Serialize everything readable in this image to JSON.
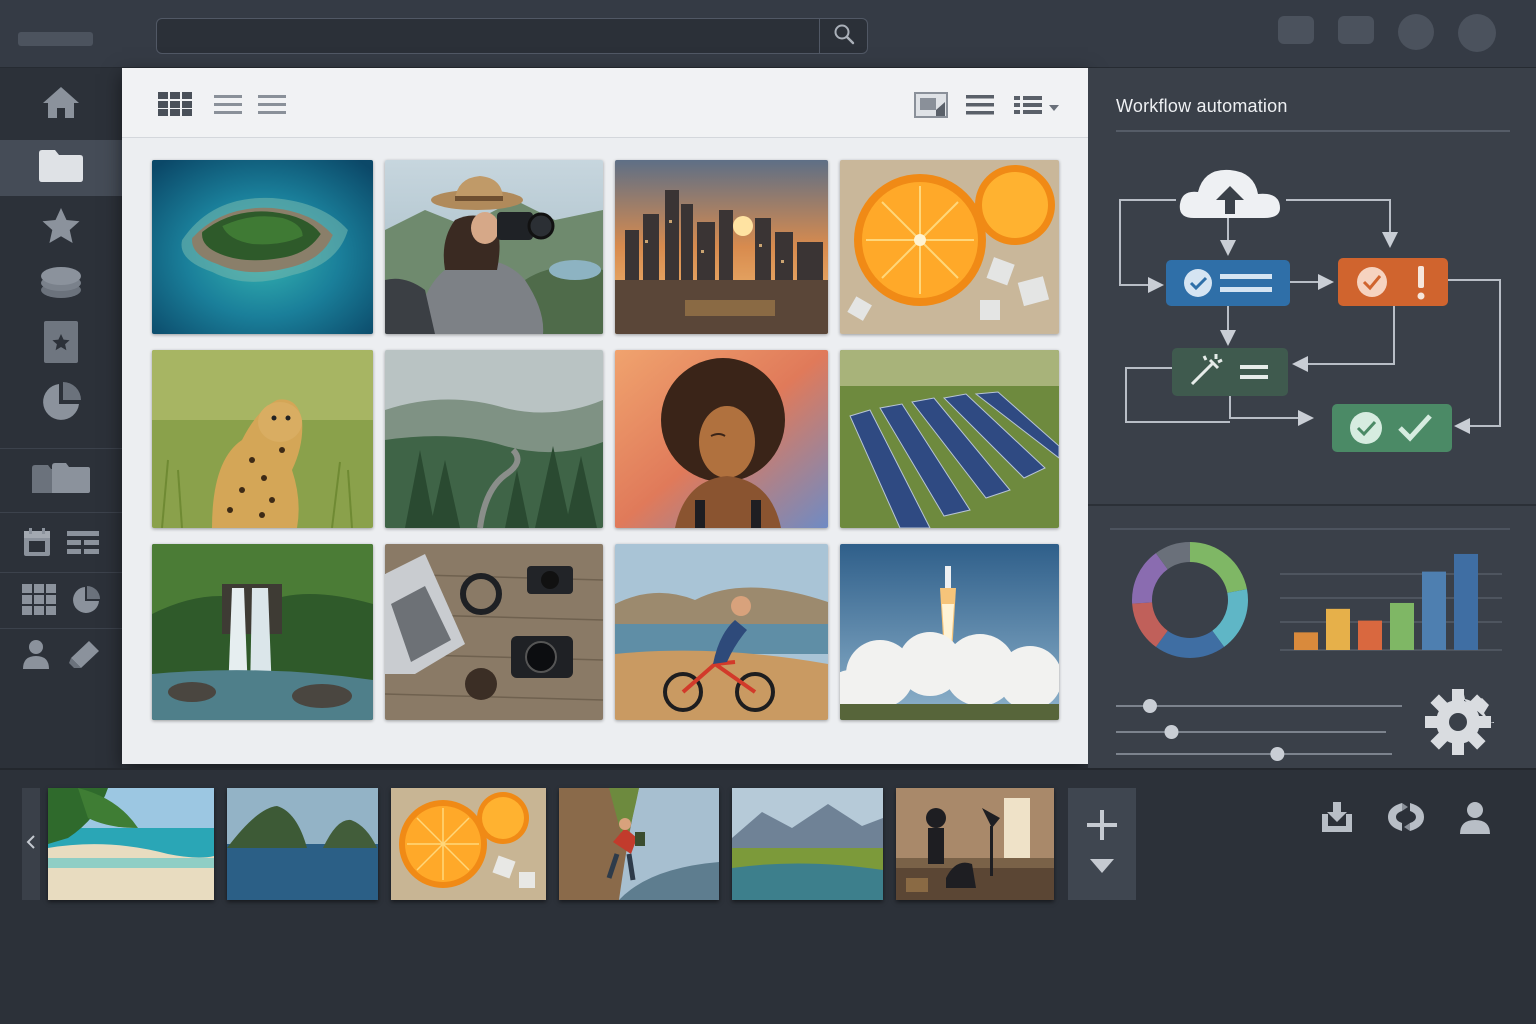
{
  "search": {
    "placeholder": "",
    "value": ""
  },
  "icons": {
    "search": "search-icon",
    "home": "home-icon",
    "folder": "folder-icon",
    "star": "star-icon",
    "stack": "stack-icon",
    "bookmark": "bookmark-star-icon",
    "pie": "pie-chart-icon",
    "folders": "folders-icon",
    "calendar": "calendar-icon",
    "list": "list-icon",
    "grid": "grid-icon",
    "user": "user-icon",
    "tag": "tag-icon",
    "gear": "gear-icon",
    "download": "download-icon",
    "sync": "sync-icon",
    "plus": "plus-icon"
  },
  "colors": {
    "accent_blue": "#2f6fa8",
    "accent_orange": "#d0642e",
    "node_dark_green": "#3f5a4e",
    "node_green": "#4b8a66",
    "donut_segments": [
      "#7fb765",
      "#5fb6c6",
      "#3f6ea3",
      "#c0605a",
      "#8a6cb0",
      "#6a707a"
    ],
    "bars": [
      "#d98a3c",
      "#e6b04a",
      "#d9683f",
      "#7fb765",
      "#4e7fb0",
      "#3f6ea3"
    ]
  },
  "workflow": {
    "title": "Workflow automation"
  },
  "charts": {
    "donut_values": [
      22,
      18,
      20,
      14,
      16,
      10
    ],
    "bar_values": [
      18,
      42,
      30,
      48,
      80,
      98
    ]
  },
  "sliders": [
    0.06,
    0.15,
    0.56
  ],
  "gallery": {
    "images": [
      "island-aerial",
      "photographer-hat",
      "city-sunset",
      "orange-ice",
      "cheetah-grass",
      "misty-forest-road",
      "curly-hair-portrait",
      "solar-farm",
      "jungle-waterfall",
      "laptop-camera-desk",
      "mountain-cyclist",
      "rocket-launch"
    ]
  },
  "filmstrip": {
    "images": [
      "tropical-beach",
      "sea-rock-islands",
      "orange-ice",
      "rock-climber",
      "mountain-valley-river",
      "photo-studio"
    ]
  }
}
